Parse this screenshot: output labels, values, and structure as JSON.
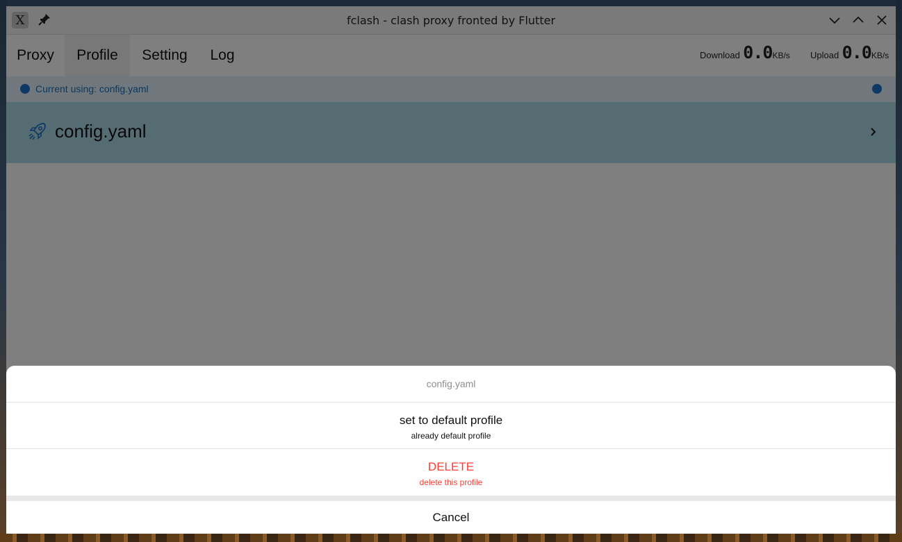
{
  "window": {
    "title": "fclash - clash proxy fronted by Flutter",
    "app_icon_glyph": "X"
  },
  "nav": {
    "tabs": [
      {
        "label": "Proxy"
      },
      {
        "label": "Profile"
      },
      {
        "label": "Setting"
      },
      {
        "label": "Log"
      }
    ]
  },
  "speed": {
    "download_label": "Download",
    "download_value": "0.0",
    "download_unit": "KB/s",
    "upload_label": "Upload",
    "upload_value": "0.0",
    "upload_unit": "KB/s"
  },
  "current": {
    "text": "Current using: config.yaml"
  },
  "profiles": [
    {
      "name": "config.yaml"
    }
  ],
  "sheet": {
    "title": "config.yaml",
    "default_label": "set to default profile",
    "default_sub": "already default profile",
    "delete_label": "DELETE",
    "delete_sub": "delete this profile",
    "cancel_label": "Cancel"
  },
  "colors": {
    "accent": "#1a73c8",
    "profile_row": "#add8e6",
    "current_bar": "#e0f0fa",
    "danger": "#ff3b30"
  }
}
